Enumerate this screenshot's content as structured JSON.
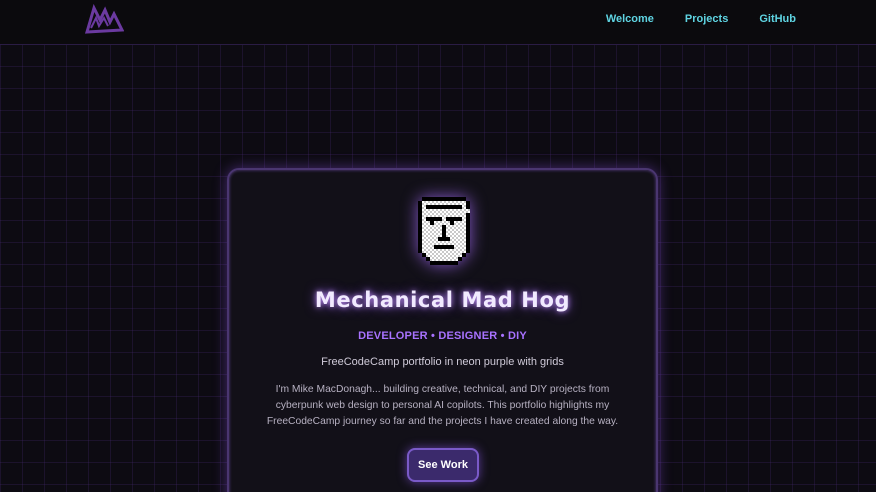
{
  "nav": {
    "logo_icon": "mountain-peaks-logo",
    "links": [
      "Welcome",
      "Projects",
      "GitHub"
    ]
  },
  "hero": {
    "avatar_icon": "pixel-face-icon",
    "name": "Mechanical Mad Hog",
    "tagline": "DEVELOPER • DESIGNER • DIY",
    "subtitle": "FreeCodeCamp portfolio in neon purple with grids",
    "bio": "I'm Mike MacDonagh... building creative, technical, and DIY projects from cyberpunk web design to personal AI copilots. This portfolio highlights my FreeCodeCamp journey so far and the projects I have created along the way.",
    "cta_label": "See Work"
  },
  "colors": {
    "background": "#0d0b12",
    "grid": "#46286e",
    "nav_link": "#5fd4e2",
    "accent_purple": "#a872ff",
    "button_bg": "#3b2a6c",
    "logo": "#6b3aa0"
  }
}
